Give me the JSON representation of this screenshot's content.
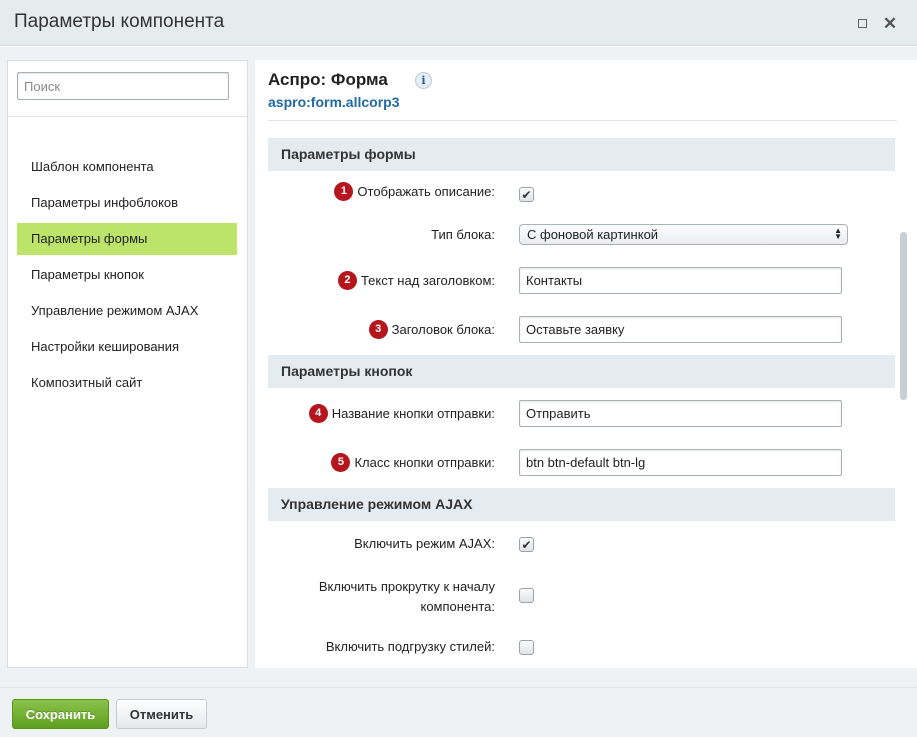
{
  "window": {
    "title": "Параметры компонента"
  },
  "sidebar": {
    "search_placeholder": "Поиск",
    "items": [
      {
        "label": "Шаблон компонента"
      },
      {
        "label": "Параметры инфоблоков"
      },
      {
        "label": "Параметры формы",
        "active": true
      },
      {
        "label": "Параметры кнопок"
      },
      {
        "label": "Управление режимом AJAX"
      },
      {
        "label": "Настройки кеширования"
      },
      {
        "label": "Композитный сайт"
      }
    ]
  },
  "component": {
    "title": "Аспро: Форма",
    "info_icon_glyph": "i",
    "code": "aspro:form.allcorp3"
  },
  "sections": {
    "form": {
      "header": "Параметры формы",
      "show_description": {
        "badge": "1",
        "label": "Отображать описание:",
        "checked": true
      },
      "block_type": {
        "label": "Тип блока:",
        "value": "С фоновой картинкой"
      },
      "text_above_title": {
        "badge": "2",
        "label": "Текст над заголовком:",
        "value": "Контакты"
      },
      "block_title": {
        "badge": "3",
        "label": "Заголовок блока:",
        "value": "Оставьте заявку"
      }
    },
    "buttons": {
      "header": "Параметры кнопок",
      "submit_name": {
        "badge": "4",
        "label": "Название кнопки отправки:",
        "value": "Отправить"
      },
      "submit_class": {
        "badge": "5",
        "label": "Класс кнопки отправки:",
        "value": "btn btn-default btn-lg"
      }
    },
    "ajax": {
      "header": "Управление режимом AJAX",
      "enable_ajax": {
        "label": "Включить режим AJAX:",
        "checked": true
      },
      "scroll_to_top": {
        "label_line1": "Включить прокрутку к началу",
        "label_line2": "компонента:",
        "checked": false
      },
      "load_styles": {
        "label": "Включить подгрузку стилей:",
        "checked": false
      }
    }
  },
  "footer": {
    "save_label": "Сохранить",
    "cancel_label": "Отменить"
  },
  "colors": {
    "accent_active": "#bde46a",
    "save_button": "#6cab2c",
    "badge": "#b5161e",
    "link": "#1f6aa5",
    "section_header": "#e4ecf2"
  },
  "icons": {
    "maximize": "maximize-icon",
    "close": "close-icon",
    "info": "info-icon",
    "check": "checkmark-icon",
    "select": "select-arrows-icon"
  }
}
